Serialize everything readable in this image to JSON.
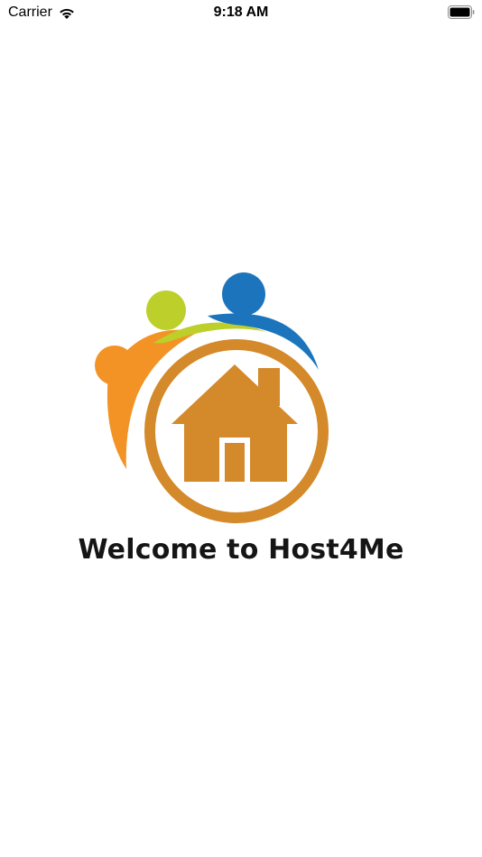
{
  "status_bar": {
    "carrier": "Carrier",
    "time": "9:18 AM",
    "wifi_icon": "wifi-icon",
    "battery_icon": "battery-icon"
  },
  "splash": {
    "welcome_text": "Welcome to Host4Me",
    "logo_icon": "house-people-logo",
    "colors": {
      "orange": "#d4892a",
      "person_orange": "#f39325",
      "person_green": "#bccf2a",
      "person_blue": "#1c75bc",
      "text": "#151515"
    }
  }
}
